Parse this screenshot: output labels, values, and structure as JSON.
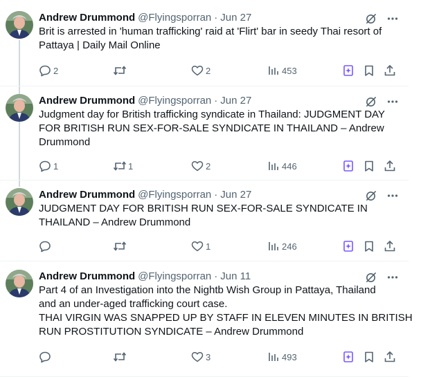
{
  "author": {
    "name": "Andrew Drummond",
    "handle": "@Flyingsporran"
  },
  "separator": "·",
  "tweets": [
    {
      "date": "Jun 27",
      "lines": [
        "Brit is arrested in 'human trafficking' raid at 'Flirt' bar in seedy Thai resort of",
        "Pattaya | Daily Mail Online"
      ],
      "replies": "2",
      "retweets": "",
      "likes": "2",
      "views": "453"
    },
    {
      "date": "Jun 27",
      "lines": [
        "Judgment day for British trafficking syndicate in Thailand: JUDGMENT DAY",
        "FOR BRITISH RUN SEX-FOR-SALE SYNDICATE IN THAILAND – Andrew",
        "Drummond"
      ],
      "replies": "1",
      "retweets": "1",
      "likes": "2",
      "views": "446"
    },
    {
      "date": "Jun 27",
      "lines": [
        "JUDGMENT DAY FOR BRITISH RUN SEX-FOR-SALE SYNDICATE IN",
        "THAILAND – Andrew Drummond"
      ],
      "replies": "",
      "retweets": "",
      "likes": "1",
      "views": "246"
    },
    {
      "date": "Jun 11",
      "lines": [
        "Part 4 of an Investigation into the Nightb Wish Group in Pattaya, Thailand",
        "and an under-aged trafficking court case.",
        "THAI VIRGIN WAS SNAPPED UP BY STAFF IN ELEVEN MINUTES IN BRITISH",
        "RUN PROSTITUTION SYNDICATE – Andrew Drummond"
      ],
      "replies": "",
      "retweets": "",
      "likes": "3",
      "views": "493"
    }
  ],
  "icons": {
    "grok": "grok-slash-icon",
    "more": "more-dots-icon",
    "reply": "reply-bubble-icon",
    "retweet": "retweet-arrows-icon",
    "like": "heart-icon",
    "views": "views-bars-icon",
    "grok_action": "grok-star-icon",
    "bookmark": "bookmark-icon",
    "share": "share-icon"
  },
  "colors": {
    "text": "#0f1419",
    "muted": "#536471",
    "accent": "#7856ff",
    "divider": "#eff3f4"
  }
}
